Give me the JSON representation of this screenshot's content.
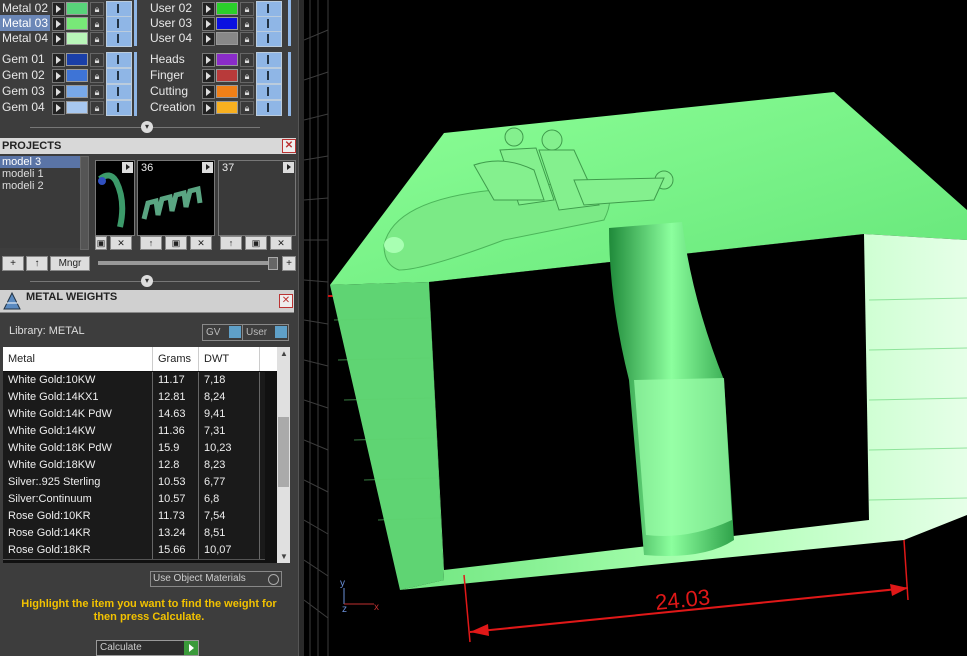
{
  "layers_left": [
    {
      "name": "Metal 02",
      "color": "#58d37a",
      "selected": false
    },
    {
      "name": "Metal 03",
      "color": "#78e878",
      "selected": true
    },
    {
      "name": "Metal 04",
      "color": "#b8f5b8",
      "selected": false
    },
    {
      "name": "Gem 01",
      "color": "#1a3fa8",
      "selected": false
    },
    {
      "name": "Gem 02",
      "color": "#3e74d6",
      "selected": false
    },
    {
      "name": "Gem 03",
      "color": "#78a8e8",
      "selected": false
    },
    {
      "name": "Gem 04",
      "color": "#a8c8f0",
      "selected": false
    }
  ],
  "layers_right": [
    {
      "name": "User 02",
      "color": "#2ad02a"
    },
    {
      "name": "User 03",
      "color": "#0a10e0"
    },
    {
      "name": "User 04",
      "color": "#888888"
    },
    {
      "name": "Heads",
      "color": "#8a2cc8"
    },
    {
      "name": "Finger",
      "color": "#b83a3a"
    },
    {
      "name": "Cutting",
      "color": "#f08018"
    },
    {
      "name": "Creation",
      "color": "#f8b020"
    }
  ],
  "projects": {
    "title": "PROJECTS",
    "items": [
      "model 3",
      "modeli 1",
      "modeli 2"
    ],
    "selected_index": 0,
    "thumbs": [
      "",
      "36",
      "37"
    ],
    "buttons": {
      "add": "+",
      "up": "↑",
      "manager": "Mngr",
      "plus": "+"
    }
  },
  "metal_weights": {
    "title": "METAL WEIGHTS",
    "library_label": "Library: METAL",
    "gv_label": "GV",
    "user_label": "User",
    "columns": [
      "Metal",
      "Grams",
      "DWT"
    ],
    "rows": [
      [
        "White Gold:10KW",
        "11.17",
        "7,18"
      ],
      [
        "White Gold:14KX1",
        "12.81",
        "8,24"
      ],
      [
        "White Gold:14K PdW",
        "14.63",
        "9,41"
      ],
      [
        "White Gold:14KW",
        "11.36",
        "7,31"
      ],
      [
        "White Gold:18K PdW",
        "15.9",
        "10,23"
      ],
      [
        "White Gold:18KW",
        "12.8",
        "8,23"
      ],
      [
        "Silver:.925 Sterling",
        "10.53",
        "6,77"
      ],
      [
        "Silver:Continuum",
        "10.57",
        "6,8"
      ],
      [
        "Rose Gold:10KR",
        "11.73",
        "7,54"
      ],
      [
        "Rose Gold:14KR",
        "13.24",
        "8,51"
      ],
      [
        "Rose Gold:18KR",
        "15.66",
        "10,07"
      ]
    ],
    "use_object_materials": "Use Object Materials",
    "hint": "Highlight the item you want to find the weight for then press Calculate.",
    "calculate": "Calculate"
  },
  "viewport": {
    "dimension_label": "24.03",
    "axis_y": "y",
    "axis_z": "z",
    "axis_x": "x",
    "model_color": "#7dff8c",
    "dimension_color": "#e01818"
  }
}
